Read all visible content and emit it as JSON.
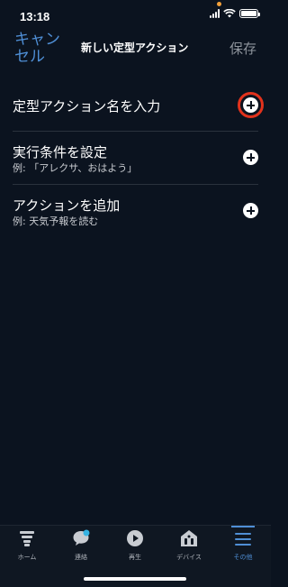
{
  "status_bar": {
    "time": "13:18"
  },
  "nav": {
    "cancel_label": "キャンセル",
    "title": "新しい定型アクション",
    "save_label": "保存"
  },
  "rows": [
    {
      "title": "定型アクション名を入力",
      "subtitle": ""
    },
    {
      "title": "実行条件を設定",
      "subtitle": "例: 「アレクサ、おはよう」"
    },
    {
      "title": "アクションを追加",
      "subtitle": "例: 天気予報を読む"
    }
  ],
  "tabs": [
    {
      "label": "ホーム",
      "icon": "home-icon"
    },
    {
      "label": "連絡",
      "icon": "chat-icon"
    },
    {
      "label": "再生",
      "icon": "play-icon"
    },
    {
      "label": "デバイス",
      "icon": "devices-icon"
    },
    {
      "label": "その他",
      "icon": "menu-icon",
      "active": true
    }
  ],
  "colors": {
    "background": "#0b131f",
    "accent": "#4f8fd6",
    "highlight": "#e2321c",
    "notification_dot": "#36b3e3"
  }
}
